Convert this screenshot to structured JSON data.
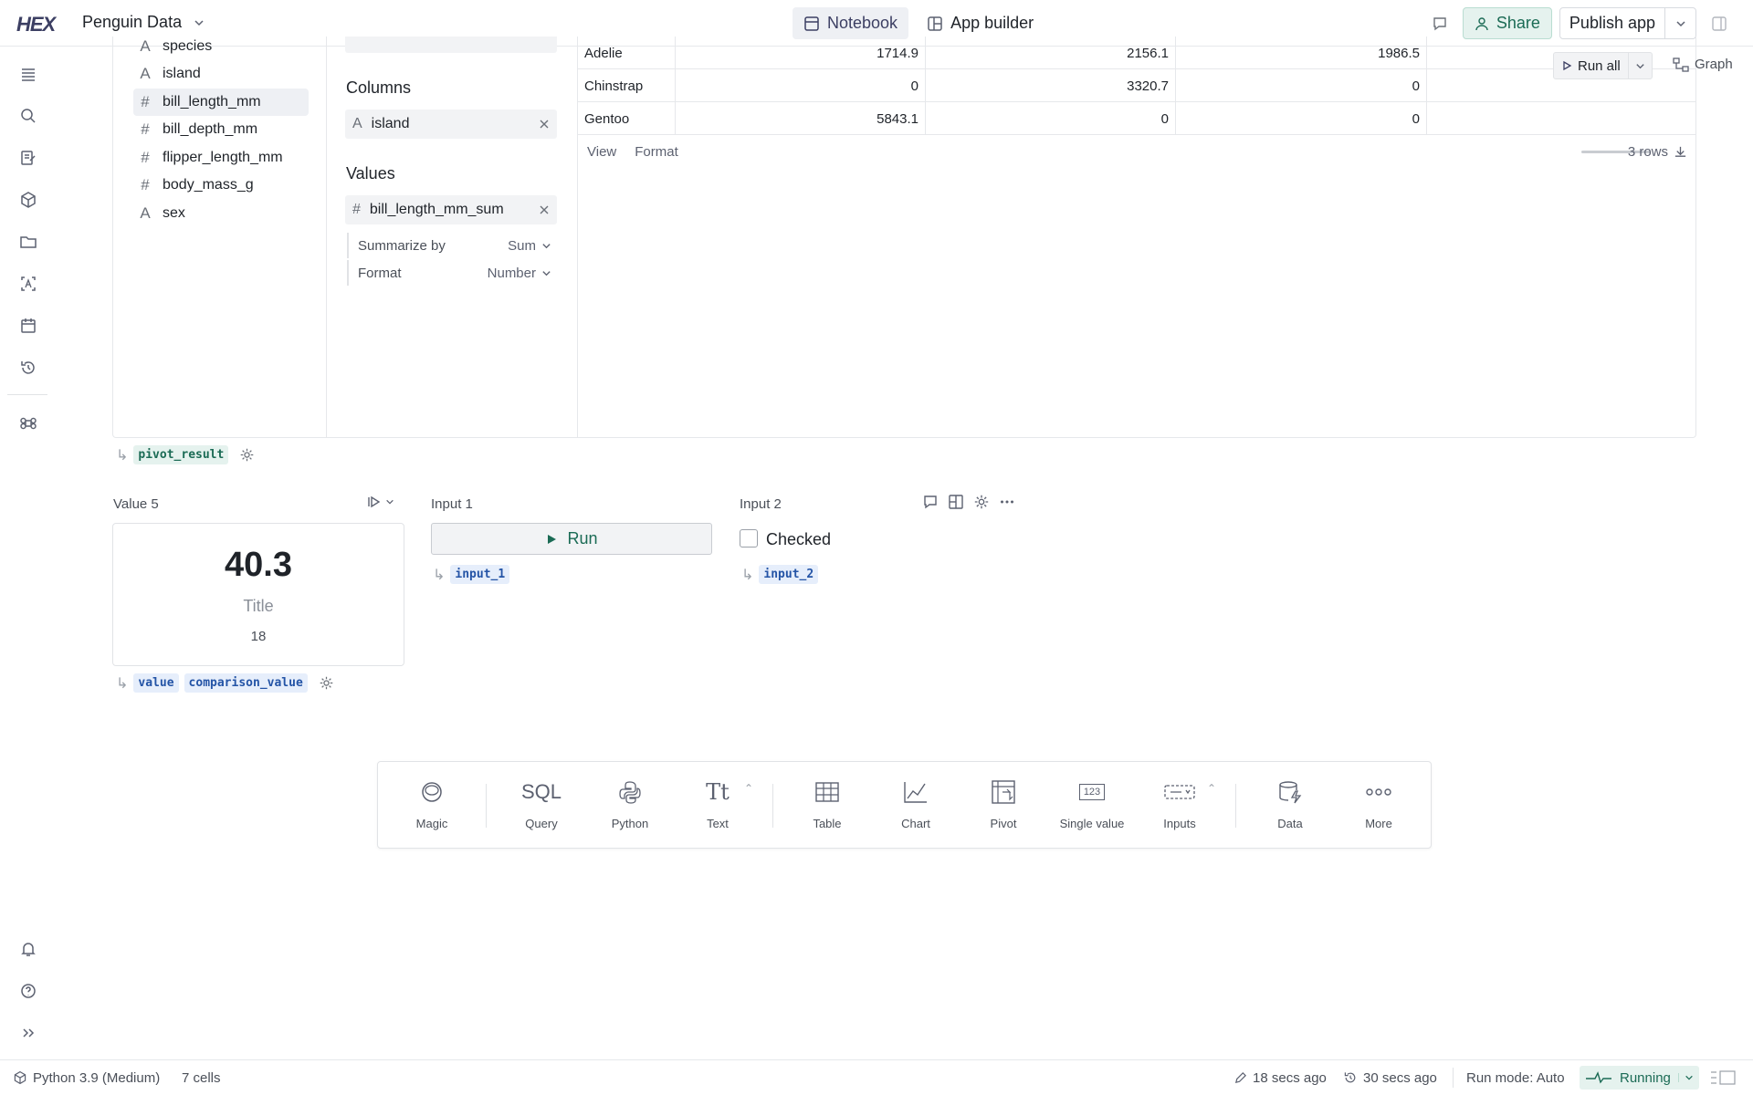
{
  "app": {
    "logo": "HEX",
    "project_title": "Penguin Data"
  },
  "modes": [
    {
      "label": "Notebook",
      "active": true
    },
    {
      "label": "App builder",
      "active": false
    }
  ],
  "topbar": {
    "share_label": "Share",
    "publish_label": "Publish app"
  },
  "pivot": {
    "fields": [
      {
        "type": "A",
        "name": "species"
      },
      {
        "type": "A",
        "name": "island"
      },
      {
        "type": "#",
        "name": "bill_length_mm",
        "selected": true
      },
      {
        "type": "#",
        "name": "bill_depth_mm"
      },
      {
        "type": "#",
        "name": "flipper_length_mm"
      },
      {
        "type": "#",
        "name": "body_mass_g"
      },
      {
        "type": "A",
        "name": "sex"
      }
    ],
    "columns_heading": "Columns",
    "columns_chip": "island",
    "values_heading": "Values",
    "values_chip": "bill_length_mm_sum",
    "summarize_label": "Summarize by",
    "summarize_value": "Sum",
    "format_label": "Format",
    "format_value": "Number",
    "rows": [
      {
        "label": "Adelie",
        "values": [
          "1714.9",
          "2156.1",
          "1986.5"
        ]
      },
      {
        "label": "Chinstrap",
        "values": [
          "0",
          "3320.7",
          "0"
        ]
      },
      {
        "label": "Gentoo",
        "values": [
          "5843.1",
          "0",
          "0"
        ]
      }
    ],
    "footer_view": "View",
    "footer_format": "Format",
    "row_count": "3 rows",
    "output_var": "pivot_result"
  },
  "toolbar": {
    "run_all_label": "Run all",
    "graph_label": "Graph"
  },
  "value_cell": {
    "label": "Value 5",
    "value": "40.3",
    "title": "Title",
    "comparison": "18",
    "output_vars": [
      "value",
      "comparison_value"
    ]
  },
  "input1": {
    "label": "Input 1",
    "button_label": "Run",
    "output_var": "input_1"
  },
  "input2": {
    "label": "Input 2",
    "checkbox_label": "Checked",
    "checked": false,
    "output_var": "input_2"
  },
  "add_cell": [
    {
      "label": "Magic",
      "icon": "magic-icon"
    },
    {
      "label": "Query",
      "icon": "sql-icon"
    },
    {
      "label": "Python",
      "icon": "python-icon"
    },
    {
      "label": "Text",
      "icon": "text-icon"
    },
    {
      "label": "Table",
      "icon": "table-icon"
    },
    {
      "label": "Chart",
      "icon": "chart-icon"
    },
    {
      "label": "Pivot",
      "icon": "pivot-icon"
    },
    {
      "label": "Single value",
      "icon": "single-value-icon"
    },
    {
      "label": "Inputs",
      "icon": "inputs-icon"
    },
    {
      "label": "Data",
      "icon": "data-icon"
    },
    {
      "label": "More",
      "icon": "more-icon"
    }
  ],
  "add_cell_sql_glyph": "SQL",
  "add_cell_text_glyph": "Tt",
  "add_cell_single_glyph": "123",
  "status": {
    "kernel": "Python 3.9 (Medium)",
    "cells": "7 cells",
    "edited": "18 secs ago",
    "ran": "30 secs ago",
    "run_mode": "Run mode: Auto",
    "state": "Running"
  },
  "colors": {
    "accent_green": "#1b6b55",
    "brand": "#3c3f63"
  }
}
